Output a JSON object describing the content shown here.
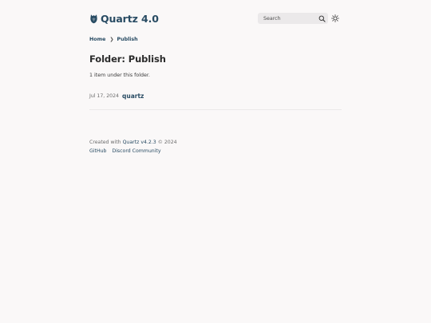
{
  "header": {
    "brand_title": "Quartz 4.0",
    "logo_icon": "quartz-logo-icon",
    "search": {
      "placeholder": "Search",
      "icon": "search-icon"
    },
    "theme_toggle_icon": "sun-icon"
  },
  "breadcrumb": {
    "items": [
      {
        "label": "Home"
      },
      {
        "label": "Publish"
      }
    ],
    "separator": "❯"
  },
  "main": {
    "title": "Folder: Publish",
    "count_text": "1 item under this folder.",
    "listing": [
      {
        "date": "Jul 17, 2024",
        "title": "quartz"
      }
    ]
  },
  "footer": {
    "created_prefix": "Created with",
    "quartz_link": "Quartz v4.2.3",
    "copyright": "© 2024",
    "links": [
      {
        "label": "GitHub"
      },
      {
        "label": "Discord Community"
      }
    ]
  },
  "colors": {
    "background": "#faf8f8",
    "accent": "#284b63",
    "text": "#2b2b2b",
    "muted": "#6b6b6b",
    "search_bg": "#ebe9ea"
  }
}
